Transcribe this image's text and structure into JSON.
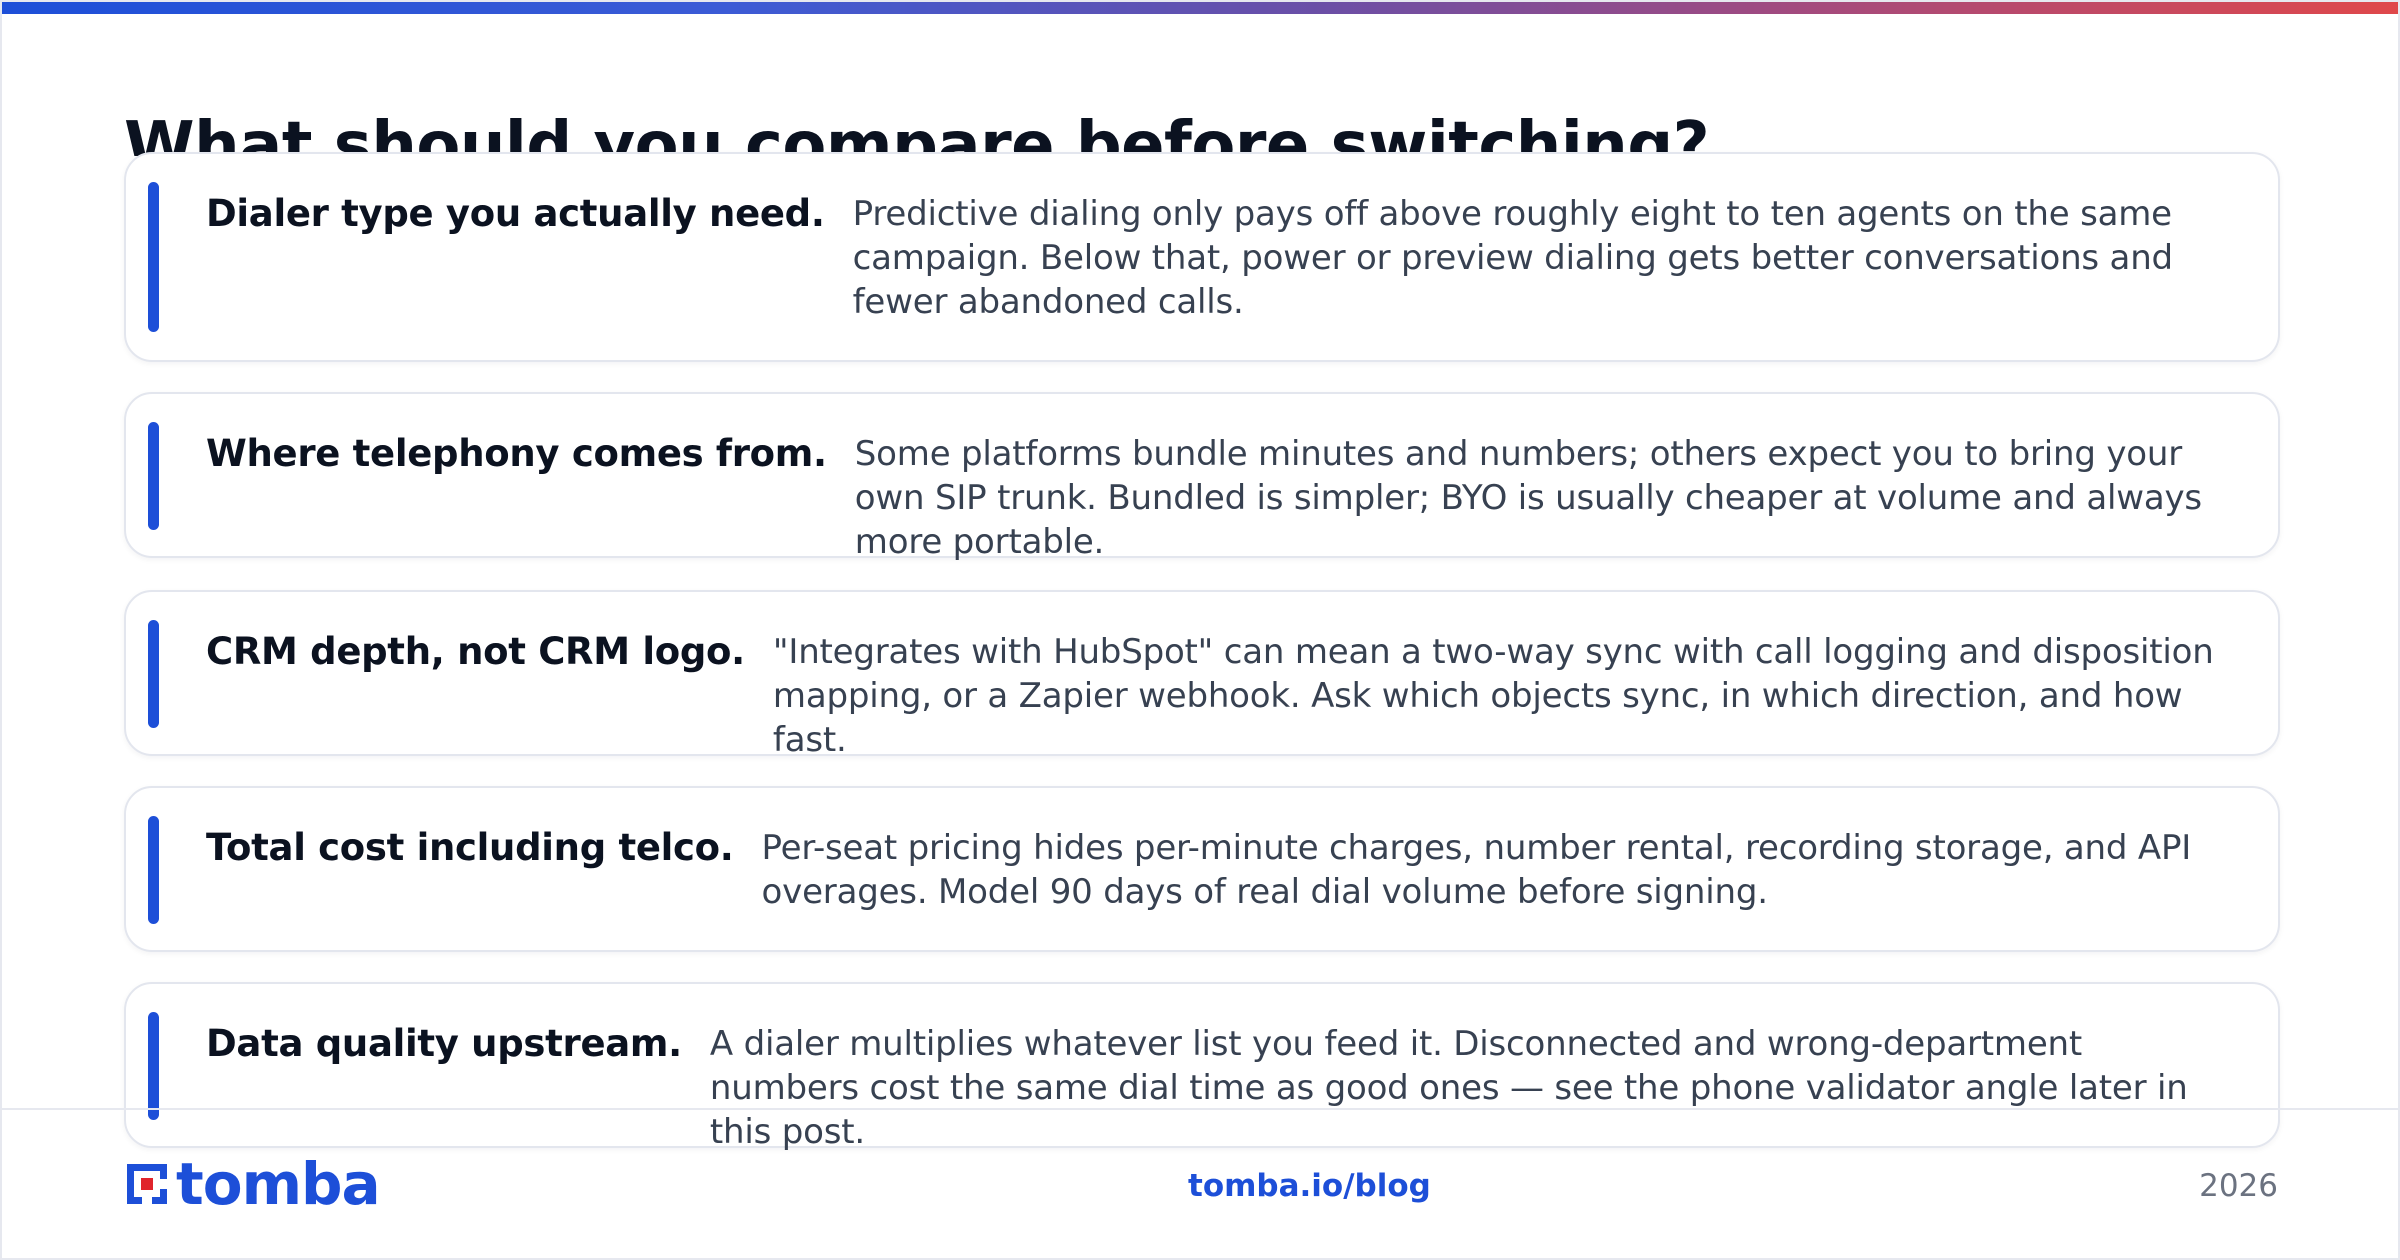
{
  "page": {
    "title": "What should you compare before switching?"
  },
  "items": [
    {
      "heading": "Dialer type you actually need.",
      "text": "Predictive dialing only pays off above roughly eight to ten agents on the same campaign. Below that, power or preview dialing gets better conversations and fewer abandoned calls."
    },
    {
      "heading": "Where telephony comes from.",
      "text": "Some platforms bundle minutes and numbers; others expect you to bring your own SIP trunk. Bundled is simpler; BYO is usually cheaper at volume and always more portable."
    },
    {
      "heading": "CRM depth, not CRM logo.",
      "text": "\"Integrates with HubSpot\" can mean a two-way sync with call logging and disposition mapping, or a Zapier webhook. Ask which objects sync, in which direction, and how fast."
    },
    {
      "heading": "Total cost including telco.",
      "text": "Per-seat pricing hides per-minute charges, number rental, recording storage, and API overages. Model 90 days of real dial volume before signing."
    },
    {
      "heading": "Data quality upstream.",
      "text": "A dialer multiplies whatever list you feed it. Disconnected and wrong-department numbers cost the same dial time as good ones — see the phone validator angle later in this post."
    }
  ],
  "footer": {
    "logo_text": "tomba",
    "link": "tomba.io/blog",
    "year": "2026"
  },
  "colors": {
    "accent": "#1d4fd8",
    "gradient_start": "#1d4fd8",
    "gradient_end": "#e0484a",
    "logo_red": "#e0242b"
  }
}
